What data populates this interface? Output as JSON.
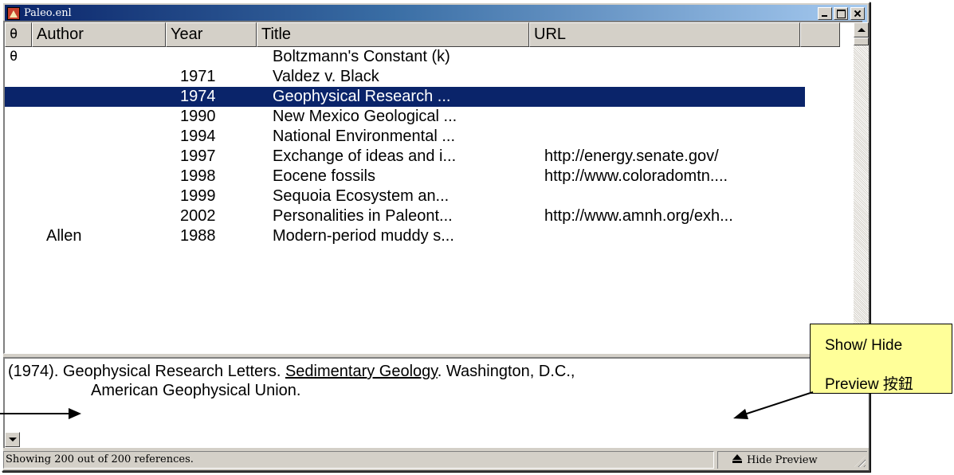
{
  "window": {
    "title": "Paleo.enl"
  },
  "columns": {
    "attachment": "θ",
    "author": "Author",
    "year": "Year",
    "title": "Title",
    "url": "URL"
  },
  "rows": [
    {
      "attachment": "θ",
      "author": "",
      "year": "",
      "title": "Boltzmann's Constant (k)",
      "url": "",
      "selected": false
    },
    {
      "attachment": "",
      "author": "",
      "year": "1971",
      "title": "Valdez v. Black",
      "url": "",
      "selected": false
    },
    {
      "attachment": "",
      "author": "",
      "year": "1974",
      "title": "Geophysical Research ...",
      "url": "",
      "selected": true
    },
    {
      "attachment": "",
      "author": "",
      "year": "1990",
      "title": "New Mexico Geological ...",
      "url": "",
      "selected": false
    },
    {
      "attachment": "",
      "author": "",
      "year": "1994",
      "title": "National Environmental ...",
      "url": "",
      "selected": false
    },
    {
      "attachment": "",
      "author": "",
      "year": "1997",
      "title": "Exchange of ideas and i...",
      "url": "http://energy.senate.gov/",
      "selected": false
    },
    {
      "attachment": "",
      "author": "",
      "year": "1998",
      "title": "Eocene fossils",
      "url": "http://www.coloradomtn....",
      "selected": false
    },
    {
      "attachment": "",
      "author": "",
      "year": "1999",
      "title": "Sequoia Ecosystem an...",
      "url": "",
      "selected": false
    },
    {
      "attachment": "",
      "author": "",
      "year": "2002",
      "title": "Personalities in Paleont...",
      "url": "http://www.amnh.org/exh...",
      "selected": false
    },
    {
      "attachment": "",
      "author": "Allen",
      "year": "1988",
      "title": "Modern-period muddy s...",
      "url": "",
      "selected": false
    }
  ],
  "preview": {
    "prefix": "(1974). Geophysical Research Letters. ",
    "journal": "Sedimentary Geology",
    "suffix": ". Washington, D.C.,",
    "line2": "American Geophysical Union."
  },
  "status": {
    "text": "Showing 200 out of 200 references.",
    "hide_preview_label": "Hide Preview"
  },
  "annotation": {
    "line1": "Show/ Hide",
    "line2": "Preview 按鈕"
  },
  "colors": {
    "selection": "#0a246a",
    "callout": "#ffff99",
    "chrome": "#d4d0c8"
  }
}
